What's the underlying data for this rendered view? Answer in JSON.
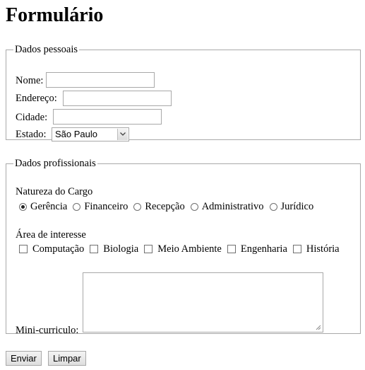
{
  "page": {
    "title": "Formulário"
  },
  "dados_pessoais": {
    "legend": "Dados pessoais",
    "nome": {
      "label": "Nome:",
      "value": ""
    },
    "endereco": {
      "label": "Endereço:",
      "value": ""
    },
    "cidade": {
      "label": "Cidade:",
      "value": ""
    },
    "estado": {
      "label": "Estado:",
      "selected": "São Paulo"
    }
  },
  "dados_profissionais": {
    "legend": "Dados profissionais",
    "natureza": {
      "label": "Natureza do Cargo",
      "options": [
        {
          "label": "Gerência",
          "checked": true
        },
        {
          "label": "Financeiro",
          "checked": false
        },
        {
          "label": "Recepção",
          "checked": false
        },
        {
          "label": "Administrativo",
          "checked": false
        },
        {
          "label": "Jurídico",
          "checked": false
        }
      ]
    },
    "interesse": {
      "label": "Área de interesse",
      "options": [
        {
          "label": "Computação",
          "checked": false
        },
        {
          "label": "Biologia",
          "checked": false
        },
        {
          "label": "Meio Ambiente",
          "checked": false
        },
        {
          "label": "Engenharia",
          "checked": false
        },
        {
          "label": "História",
          "checked": false
        }
      ]
    },
    "mini_curriculo": {
      "label": "Mini-curriculo:",
      "value": ""
    }
  },
  "buttons": {
    "enviar": "Enviar",
    "limpar": "Limpar"
  },
  "icons": {
    "select_arrow": "chevron-down-icon",
    "resize_grip": "resize-grip-icon"
  }
}
